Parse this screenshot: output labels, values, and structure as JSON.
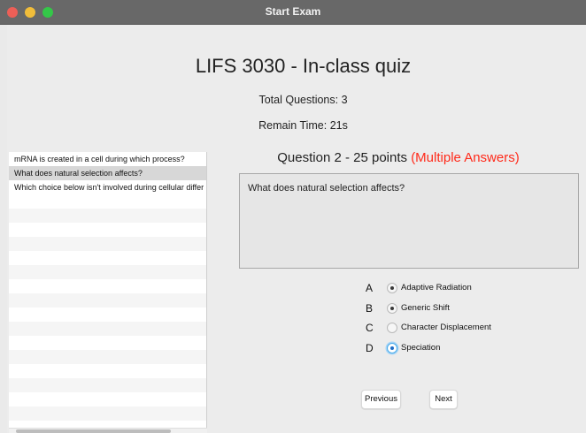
{
  "window": {
    "title": "Start Exam"
  },
  "quiz": {
    "title": "LIFS 3030 - In-class quiz",
    "total_questions": "Total Questions: 3",
    "remain_time": "Remain Time: 21s"
  },
  "question_list": {
    "items": [
      {
        "label": "mRNA is created in a cell during which process?",
        "selected": false
      },
      {
        "label": "What does natural selection affects?",
        "selected": true
      },
      {
        "label": "Which choice below isn't involved during cellular differ",
        "selected": false
      }
    ]
  },
  "question": {
    "header": "Question 2 - 25 points",
    "type_label": "(Multiple Answers)",
    "text": "What does natural selection affects?",
    "options": [
      {
        "letter": "A",
        "label": "Adaptive Radiation",
        "checked": true
      },
      {
        "letter": "B",
        "label": "Generic Shift",
        "checked": true
      },
      {
        "letter": "C",
        "label": "Character Displacement",
        "checked": false
      },
      {
        "letter": "D",
        "label": "Speciation",
        "checked": true
      }
    ]
  },
  "nav": {
    "previous_label": "Previous",
    "next_label": "Next"
  },
  "colors": {
    "accent_red": "#ff2a1a",
    "focus_blue": "#48a9e8",
    "titlebar": "#686868"
  }
}
